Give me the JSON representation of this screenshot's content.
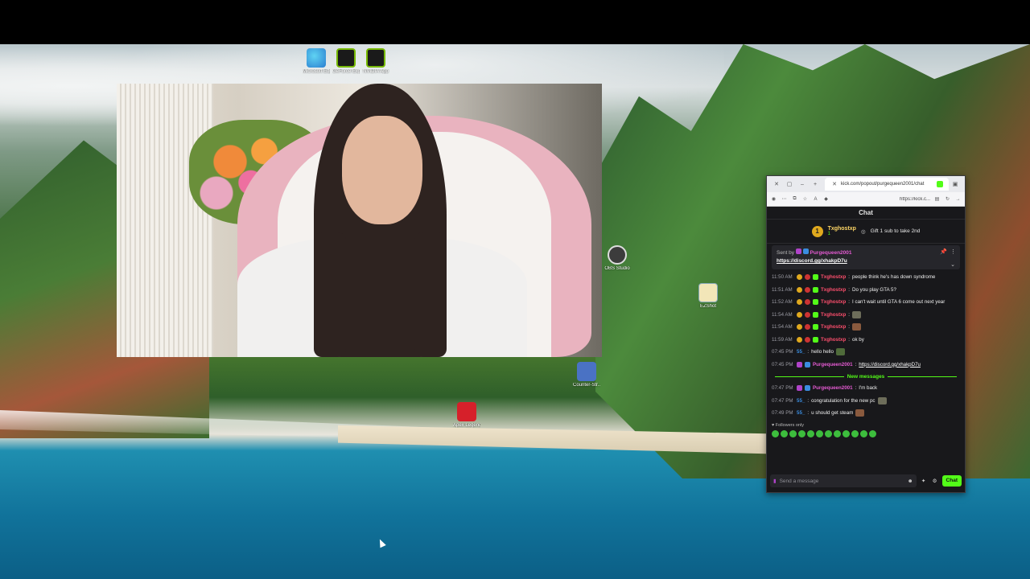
{
  "desktop": {
    "icons": [
      {
        "name": "edge-desktop-icon",
        "label": "Microsoft Edge",
        "color": "#2b7fd0"
      },
      {
        "name": "nvidia-app-icon-1",
        "label": "GeForce Exper...",
        "color": "#76b900"
      },
      {
        "name": "nvidia-app-icon-2",
        "label": "NVIDIA App",
        "color": "#76b900"
      },
      {
        "name": "obs-desktop-icon",
        "label": "OBS Studio",
        "color": "#3c3c3c"
      },
      {
        "name": "ezshot-desktop-icon",
        "label": "EZShot",
        "color": "#f2e6b8"
      },
      {
        "name": "counter-strike-desktop-icon",
        "label": "Counter-Str...",
        "color": "#4a72c4"
      },
      {
        "name": "apex-desktop-icon",
        "label": "Apex Legends",
        "color": "#d6202a"
      }
    ]
  },
  "browser": {
    "tab_title": "kick.com/popout/purgequeen2001/chat",
    "address": "https://kick.c..."
  },
  "chat": {
    "title": "Chat",
    "gift_leader": {
      "rank": "1",
      "user": "Txghostxp",
      "count": "1",
      "text": "Gift 1 sub to take 2nd"
    },
    "pinned": {
      "sent_by_label": "Sent by",
      "user": "Purgequeen2001",
      "link": "https://discord.gg/xhakpD7u"
    },
    "messages": [
      {
        "time": "11:50 AM",
        "user": "Txghostxp",
        "user_color": "red",
        "text": "people think he's has down syndrome"
      },
      {
        "time": "11:51 AM",
        "user": "Txghostxp",
        "user_color": "red",
        "text": "Do you play GTA 5?"
      },
      {
        "time": "11:52 AM",
        "user": "Txghostxp",
        "user_color": "red",
        "text": "I can't wait until GTA 6 come out next year"
      },
      {
        "time": "11:54 AM",
        "user": "Txghostxp",
        "user_color": "red",
        "text": ""
      },
      {
        "time": "11:54 AM",
        "user": "Txghostxp",
        "user_color": "red",
        "text": ""
      },
      {
        "time": "11:59 AM",
        "user": "Txghostxp",
        "user_color": "red",
        "text": "ok by"
      },
      {
        "time": "07:45 PM",
        "user": "55_",
        "user_color": "blue",
        "text": "hello hello"
      },
      {
        "time": "07:45 PM",
        "user": "Purgequeen2001",
        "user_color": "pink",
        "text": "https://discord.gg/xhakpD7u"
      }
    ],
    "new_messages_label": "New messages",
    "new_messages": [
      {
        "time": "07:47 PM",
        "user": "Purgequeen2001",
        "user_color": "pink",
        "text": "I'm back"
      },
      {
        "time": "07:47 PM",
        "user": "55_",
        "user_color": "blue",
        "text": "congratulation for the new pc"
      },
      {
        "time": "07:49 PM",
        "user": "55_",
        "user_color": "blue",
        "text": "u should get steam"
      }
    ],
    "followers_only": "Followers only",
    "input_placeholder": "Send a message",
    "send_label": "Chat"
  }
}
